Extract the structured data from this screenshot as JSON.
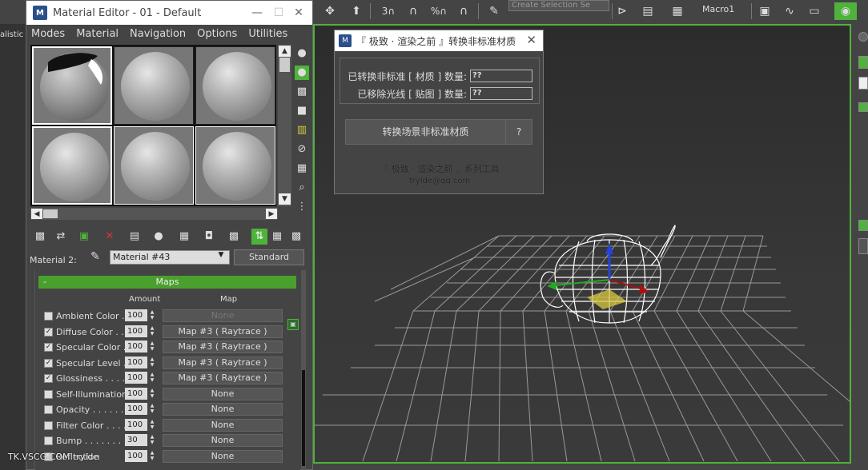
{
  "background": {
    "viewport_label": "alistic ]",
    "selection_set_placeholder": "Create Selection Se",
    "macro_label": "Macro1",
    "accent_color": "#4fb23b"
  },
  "material_editor": {
    "title": "Material Editor - 01 - Default",
    "menu": [
      "Modes",
      "Material",
      "Navigation",
      "Options",
      "Utilities"
    ],
    "material_label": "Material 2:",
    "material_name": "Material #43",
    "material_type": "Standard",
    "maps_rollout_title": "Maps",
    "col_amount": "Amount",
    "col_map": "Map",
    "maps": [
      {
        "name": "Ambient Color . .",
        "checked": false,
        "amount": "100",
        "map": "None",
        "disabled": true
      },
      {
        "name": "Diffuse Color . . .",
        "checked": true,
        "amount": "100",
        "map": "Map #3  ( Raytrace )"
      },
      {
        "name": "Specular Color  .",
        "checked": true,
        "amount": "100",
        "map": "Map #3  ( Raytrace )"
      },
      {
        "name": "Specular Level  .",
        "checked": true,
        "amount": "100",
        "map": "Map #3  ( Raytrace )"
      },
      {
        "name": "Glossiness  . . . .",
        "checked": true,
        "amount": "100",
        "map": "Map #3  ( Raytrace )"
      },
      {
        "name": "Self-Illumination .",
        "checked": false,
        "amount": "100",
        "map": "None"
      },
      {
        "name": "Opacity . . . . . .",
        "checked": false,
        "amount": "100",
        "map": "None"
      },
      {
        "name": "Filter Color  . . . .",
        "checked": false,
        "amount": "100",
        "map": "None"
      },
      {
        "name": "Bump  . . . . . . .",
        "checked": false,
        "amount": "30",
        "map": "None"
      },
      {
        "name": "Reflection",
        "checked": false,
        "amount": "100",
        "map": "None"
      }
    ],
    "check_mark": "✓"
  },
  "converter_dialog": {
    "title": "『 极致 · 渲染之前 』转换非标准材质",
    "converted_label": "已转换非标准 [ 材质 ] 数量:",
    "converted_value": "??",
    "removed_label": "已移除光线 [ 贴图 ] 数量:",
    "removed_value": "??",
    "convert_button": "转换场景非标准材质",
    "help_button": "?",
    "footer_line1": "『 极致 · 渲染之前 』系列工具",
    "footer_line2": "trylde@qq.com"
  },
  "watermark": "TK.VSCG.COM  trylde"
}
